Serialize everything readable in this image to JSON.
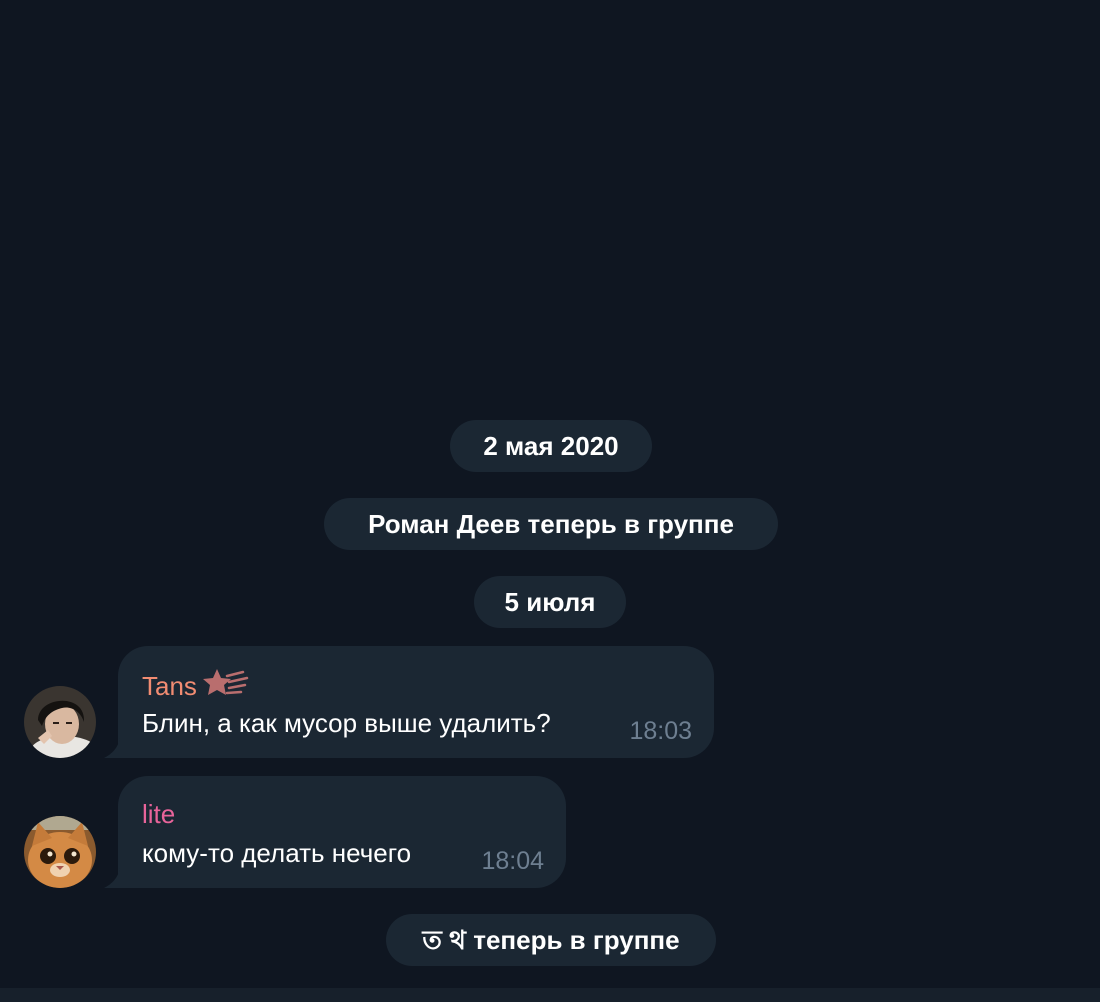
{
  "chat": {
    "service_messages": [
      {
        "text": "2 мая 2020"
      },
      {
        "text": "Роман Деев теперь в группе"
      },
      {
        "text": "5 июля"
      },
      {
        "text": "ত থ теперь в группе"
      }
    ],
    "messages": [
      {
        "sender": "Tans",
        "sender_color": "#f28c72",
        "badge_icon": "star-icon",
        "text": "Блин, а как мусор выше удалить?",
        "time": "18:03",
        "avatar_icon": "user-photo-avatar"
      },
      {
        "sender": "lite",
        "sender_color": "#e8649a",
        "text": "кому-то делать нечего",
        "time": "18:04",
        "avatar_icon": "cat-photo-avatar"
      }
    ]
  },
  "colors": {
    "background": "#0f1621",
    "bubble": "#1b2733",
    "time": "#6e7f91"
  }
}
